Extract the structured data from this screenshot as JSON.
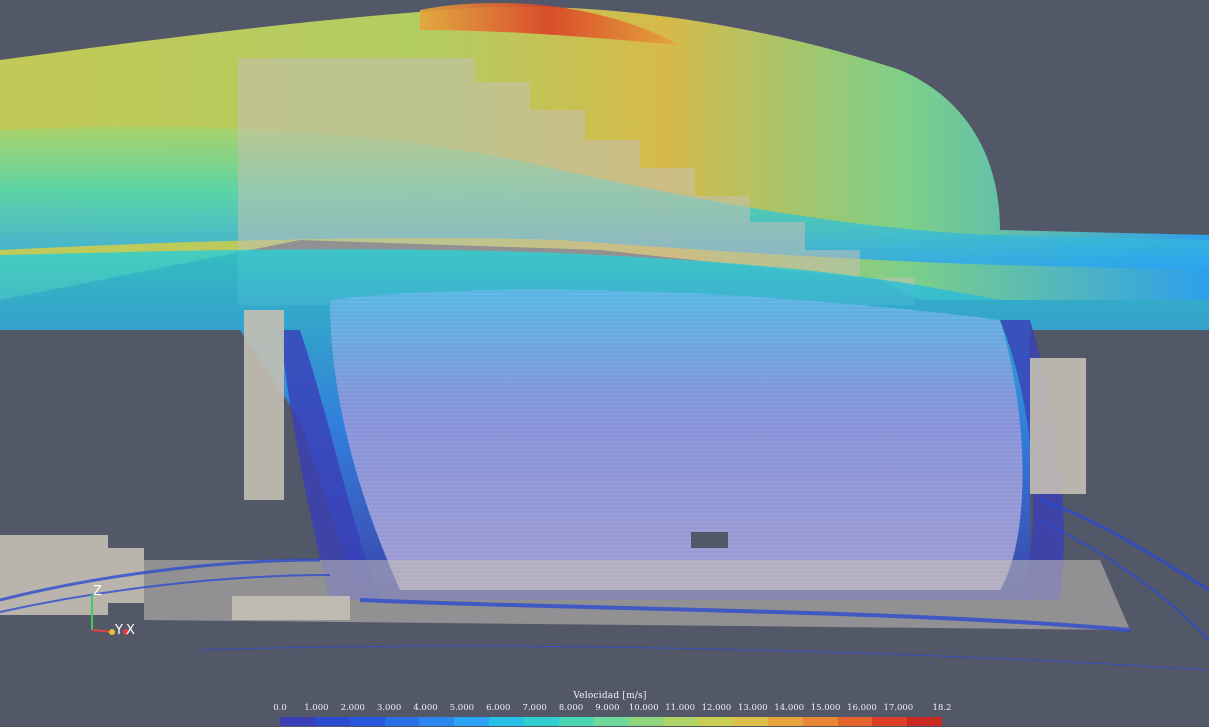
{
  "chart_data": {
    "type": "heatmap",
    "description_kind": "streamline velocity field",
    "colorbar": {
      "title": "Velocidad [m/s]",
      "range": [
        0.0,
        18.2
      ],
      "tick_labels": [
        "0.0",
        "1.000",
        "2.000",
        "3.000",
        "4.000",
        "5.000",
        "6.000",
        "7.000",
        "8.000",
        "9.000",
        "10.000",
        "11.000",
        "12.000",
        "13.000",
        "14.000",
        "15.000",
        "16.000",
        "17.000",
        "18.2"
      ],
      "tick_values": [
        0,
        1,
        2,
        3,
        4,
        5,
        6,
        7,
        8,
        9,
        10,
        11,
        12,
        13,
        14,
        15,
        16,
        17,
        18.2
      ],
      "colors": [
        "#3a3fb8",
        "#2c4bd0",
        "#2758dc",
        "#2a6fe6",
        "#2c86f0",
        "#2aa3f2",
        "#26bfe6",
        "#2fcfd0",
        "#4ad6b4",
        "#6fd89a",
        "#8ed67e",
        "#aed468",
        "#c9cf55",
        "#ddbf47",
        "#e6a53c",
        "#e88634",
        "#e4632c",
        "#dc4026",
        "#c82a22"
      ]
    },
    "orientation_axes": [
      "Z",
      "Y",
      "X"
    ]
  },
  "scene": {
    "background": "#535868",
    "geometry_color": "#c4c0b4"
  }
}
